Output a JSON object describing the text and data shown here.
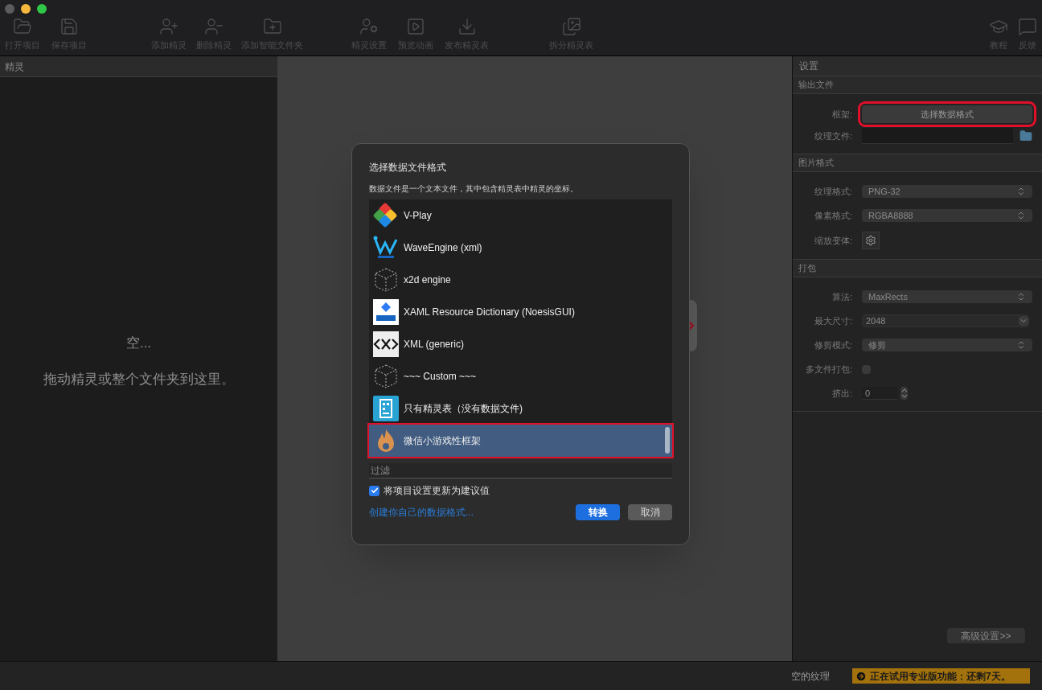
{
  "toolbar": [
    {
      "label": "打开项目"
    },
    {
      "label": "保存项目"
    },
    {
      "label": "添加精灵"
    },
    {
      "label": "删除精灵"
    },
    {
      "label": "添加智能文件夹"
    },
    {
      "label": "精灵设置"
    },
    {
      "label": "预览动画"
    },
    {
      "label": "发布精灵表"
    },
    {
      "label": "拆分精灵表"
    },
    {
      "label": "教程"
    },
    {
      "label": "反馈"
    }
  ],
  "sprites_panel": {
    "title": "精灵",
    "empty_title": "空...",
    "empty_hint": "拖动精灵或整个文件夹到这里。"
  },
  "settings": {
    "title": "设置",
    "sections": [
      {
        "title": "输出文件",
        "rows": [
          {
            "kind": "button",
            "label": "框架:",
            "value": "选择数据格式",
            "highlighted": true
          },
          {
            "kind": "file",
            "label": "纹理文件:"
          }
        ]
      },
      {
        "title": "图片格式",
        "rows": [
          {
            "kind": "select",
            "label": "纹理格式:",
            "value": "PNG-32"
          },
          {
            "kind": "select",
            "label": "像素格式:",
            "value": "RGBA8888"
          },
          {
            "kind": "gear",
            "label": "缩放变体:"
          }
        ]
      },
      {
        "title": "打包",
        "rows": [
          {
            "kind": "select",
            "label": "算法:",
            "value": "MaxRects"
          },
          {
            "kind": "combo",
            "label": "最大尺寸:",
            "value": "2048"
          },
          {
            "kind": "select",
            "label": "修剪模式:",
            "value": "修剪"
          },
          {
            "kind": "checkbox",
            "label": "多文件打包:",
            "checked": false
          },
          {
            "kind": "stepper",
            "label": "挤出:",
            "value": "0"
          }
        ]
      }
    ],
    "advanced_button": "高级设置>>"
  },
  "dialog": {
    "title": "选择数据文件格式",
    "description": "数据文件是一个文本文件，其中包含精灵表中精灵的坐标。",
    "items": [
      {
        "label": "V-Play",
        "selected": false,
        "highlighted": false
      },
      {
        "label": "WaveEngine (xml)",
        "selected": false,
        "highlighted": false
      },
      {
        "label": "x2d engine",
        "selected": false,
        "highlighted": false
      },
      {
        "label": "XAML Resource Dictionary (NoesisGUI)",
        "selected": false,
        "highlighted": false
      },
      {
        "label": "XML (generic)",
        "selected": false,
        "highlighted": false
      },
      {
        "label": "~~~ Custom ~~~",
        "selected": false,
        "highlighted": false
      },
      {
        "label": "只有精灵表（没有数据文件)",
        "selected": false,
        "highlighted": false
      },
      {
        "label": "微信小游戏性框架",
        "selected": true,
        "highlighted": true
      }
    ],
    "filter_placeholder": "过滤",
    "update_checkbox": {
      "label": "将项目设置更新为建议值",
      "checked": true
    },
    "link": "创建你自己的数据格式...",
    "ok": "转换",
    "cancel": "取消"
  },
  "status_bar": {
    "texture": "空的纹理",
    "trial": "正在试用专业版功能：还剩7天。"
  }
}
